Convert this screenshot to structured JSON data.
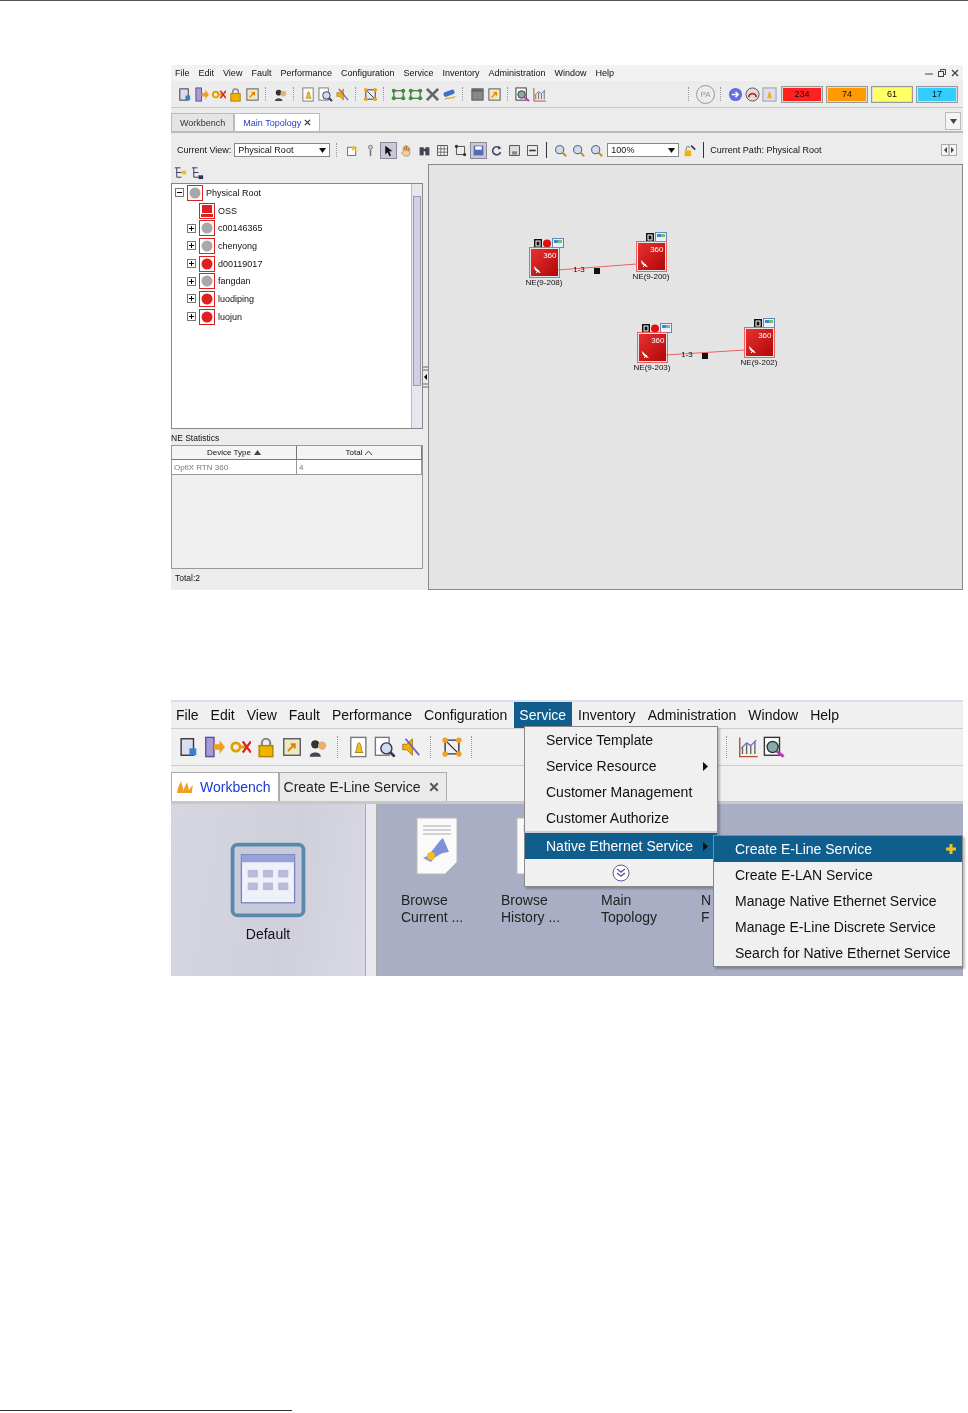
{
  "screenshot_1": {
    "menu": [
      "File",
      "Edit",
      "View",
      "Fault",
      "Performance",
      "Configuration",
      "Service",
      "Inventory",
      "Administration",
      "Window",
      "Help"
    ],
    "pa_badge": "PA",
    "alarm_counts": [
      {
        "count": "234",
        "color": "#ff2020"
      },
      {
        "count": "74",
        "color": "#ff9900"
      },
      {
        "count": "61",
        "color": "#ffff66"
      },
      {
        "count": "17",
        "color": "#33ccff"
      }
    ],
    "tabs": [
      {
        "label": "Workbench",
        "selected": false,
        "closable": false
      },
      {
        "label": "Main Topology",
        "selected": true,
        "closable": true
      }
    ],
    "current_view_label": "Current View:",
    "current_view": "Physical Root",
    "zoom": "100%",
    "current_path": "Current Path: Physical Root",
    "tree": {
      "label": "Physical Root",
      "expanded": true,
      "children": [
        {
          "label": "OSS",
          "kind": "server",
          "color": "#e02020"
        },
        {
          "label": "c00146365",
          "kind": "group",
          "expanded": false,
          "color": "#a8a8a8"
        },
        {
          "label": "chenyong",
          "kind": "group",
          "expanded": false,
          "color": "#a8a8a8"
        },
        {
          "label": "d00119017",
          "kind": "group",
          "expanded": false,
          "color": "#e02020"
        },
        {
          "label": "fangdan",
          "kind": "group",
          "expanded": false,
          "color": "#a8a8a8"
        },
        {
          "label": "luodiping",
          "kind": "group",
          "expanded": false,
          "color": "#e02020"
        },
        {
          "label": "luojun",
          "kind": "group",
          "expanded": false,
          "color": "#e02020"
        }
      ]
    },
    "statistics": {
      "title": "NE Statistics",
      "columns": [
        "Device Type",
        "Total"
      ],
      "rows": [
        [
          "OptiX RTN 360",
          "4"
        ]
      ],
      "footer": "Total:2"
    },
    "topology": {
      "nodes": [
        {
          "label": "NE(9-208)",
          "model": "360",
          "alarm": true
        },
        {
          "label": "NE(9-200)",
          "model": "360",
          "alarm": false
        },
        {
          "label": "NE(9-203)",
          "model": "360",
          "alarm": true
        },
        {
          "label": "NE(9-202)",
          "model": "360",
          "alarm": false
        }
      ],
      "links": [
        {
          "label": "1-3"
        },
        {
          "label": "1-3"
        }
      ]
    }
  },
  "screenshot_2": {
    "menu": [
      {
        "label": "File",
        "selected": false
      },
      {
        "label": "Edit",
        "selected": false
      },
      {
        "label": "View",
        "selected": false
      },
      {
        "label": "Fault",
        "selected": false
      },
      {
        "label": "Performance",
        "selected": false
      },
      {
        "label": "Configuration",
        "selected": false
      },
      {
        "label": "Service",
        "selected": true
      },
      {
        "label": "Inventory",
        "selected": false
      },
      {
        "label": "Administration",
        "selected": false
      },
      {
        "label": "Window",
        "selected": false
      },
      {
        "label": "Help",
        "selected": false
      }
    ],
    "tabs": [
      {
        "label": "Workbench",
        "selected": true,
        "closable": false
      },
      {
        "label": "Create E-Line Service",
        "selected": false,
        "closable": true
      }
    ],
    "default_tile": "Default",
    "launcher": [
      {
        "lines": [
          "Browse",
          "Current ..."
        ]
      },
      {
        "lines": [
          "Browse",
          "History ..."
        ]
      },
      {
        "lines": [
          "Main",
          "Topology"
        ]
      },
      {
        "lines": [
          "N",
          "F"
        ]
      }
    ],
    "service_menu": [
      {
        "label": "Service Template",
        "submenu": false,
        "selected": false
      },
      {
        "label": "Service Resource",
        "submenu": true,
        "selected": false
      },
      {
        "label": "Customer Management",
        "submenu": false,
        "selected": false
      },
      {
        "label": "Customer Authorize",
        "submenu": false,
        "selected": false
      },
      {
        "label": "Native Ethernet Service",
        "submenu": true,
        "selected": true
      }
    ],
    "submenu": [
      {
        "label": "Create E-Line Service",
        "selected": true
      },
      {
        "label": "Create E-LAN Service",
        "selected": false
      },
      {
        "label": "Manage Native Ethernet Service",
        "selected": false
      },
      {
        "label": "Manage E-Line Discrete Service",
        "selected": false
      },
      {
        "label": "Search for Native Ethernet Service",
        "selected": false
      }
    ]
  }
}
